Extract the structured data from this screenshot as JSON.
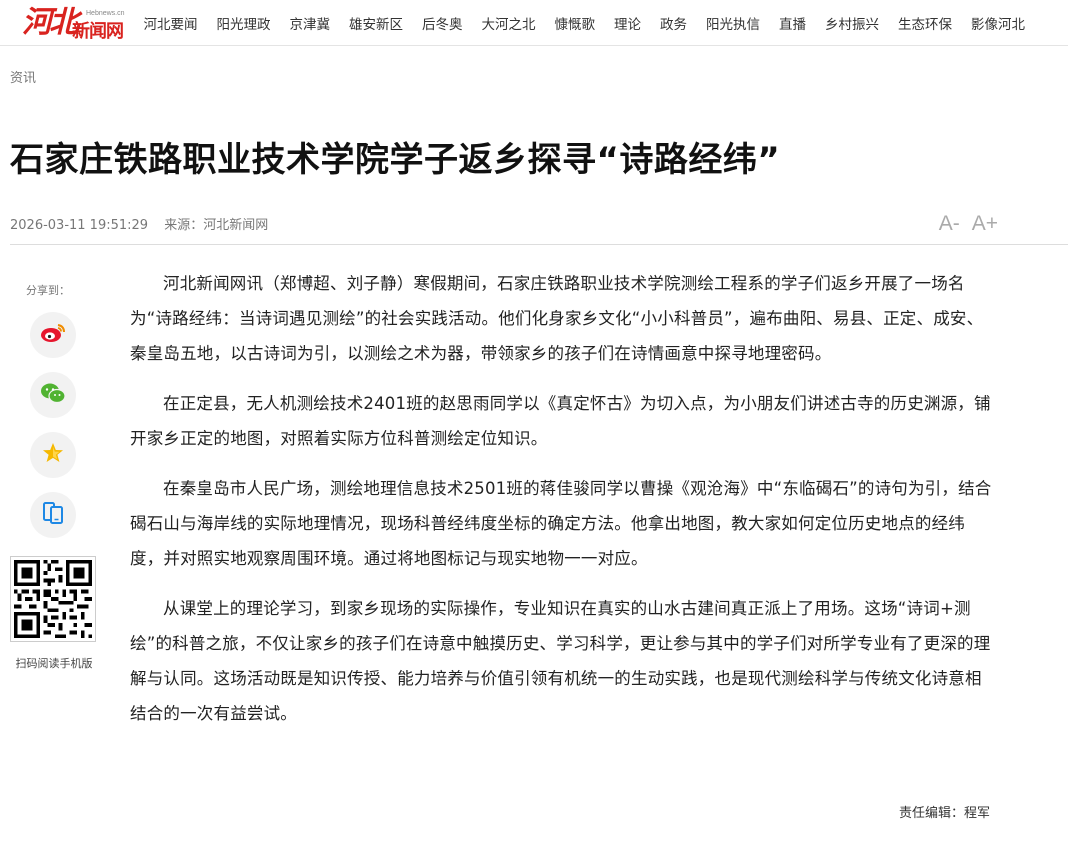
{
  "header": {
    "logo_mark": "河北",
    "logo_site": "Hebnews.cn",
    "logo_name": "新闻网",
    "nav": [
      "河北要闻",
      "阳光理政",
      "京津冀",
      "雄安新区",
      "后冬奥",
      "大河之北",
      "慷慨歌",
      "理论",
      "政务",
      "阳光执信",
      "直播",
      "乡村振兴",
      "生态环保",
      "影像河北"
    ]
  },
  "breadcrumb": "资讯",
  "article": {
    "title": "石家庄铁路职业技术学院学子返乡探寻“诗路经纬”",
    "datetime": "2026-03-11 19:51:29",
    "source": "来源：河北新闻网",
    "font_decrease": "A-",
    "font_increase": "A+",
    "paragraphs": [
      "河北新闻网讯（郑博超、刘子静）寒假期间，石家庄铁路职业技术学院测绘工程系的学子们返乡开展了一场名为“诗路经纬：当诗词遇见测绘”的社会实践活动。他们化身家乡文化“小小科普员”，遍布曲阳、易县、正定、成安、秦皇岛五地，以古诗词为引，以测绘之术为器，带领家乡的孩子们在诗情画意中探寻地理密码。",
      "在正定县，无人机测绘技术2401班的赵思雨同学以《真定怀古》为切入点，为小朋友们讲述古寺的历史渊源，铺开家乡正定的地图，对照着实际方位科普测绘定位知识。",
      "在秦皇岛市人民广场，测绘地理信息技术2501班的蒋佳骏同学以曹操《观沧海》中“东临碣石”的诗句为引，结合碣石山与海岸线的实际地理情况，现场科普经纬度坐标的确定方法。他拿出地图，教大家如何定位历史地点的经纬度，并对照实地观察周围环境。通过将地图标记与现实地物一一对应。",
      "从课堂上的理论学习，到家乡现场的实际操作，专业知识在真实的山水古建间真正派上了用场。这场“诗词+测绘”的科普之旅，不仅让家乡的孩子们在诗意中触摸历史、学习科学，更让参与其中的学子们对所学专业有了更深的理解与认同。这场活动既是知识传授、能力培养与价值引领有机统一的生动实践，也是现代测绘科学与传统文化诗意相结合的一次有益尝试。"
    ],
    "editor": "责任编辑：程军"
  },
  "share": {
    "label": "分享到：",
    "buttons": [
      "weibo-icon",
      "wechat-icon",
      "qzone-star-icon",
      "mobile-icon"
    ],
    "qr_label": "扫码阅读手机版",
    "colors": {
      "weibo": "#e6162d",
      "wechat": "#51b332",
      "star": "#f5b800",
      "mobile": "#1e88e5"
    }
  }
}
